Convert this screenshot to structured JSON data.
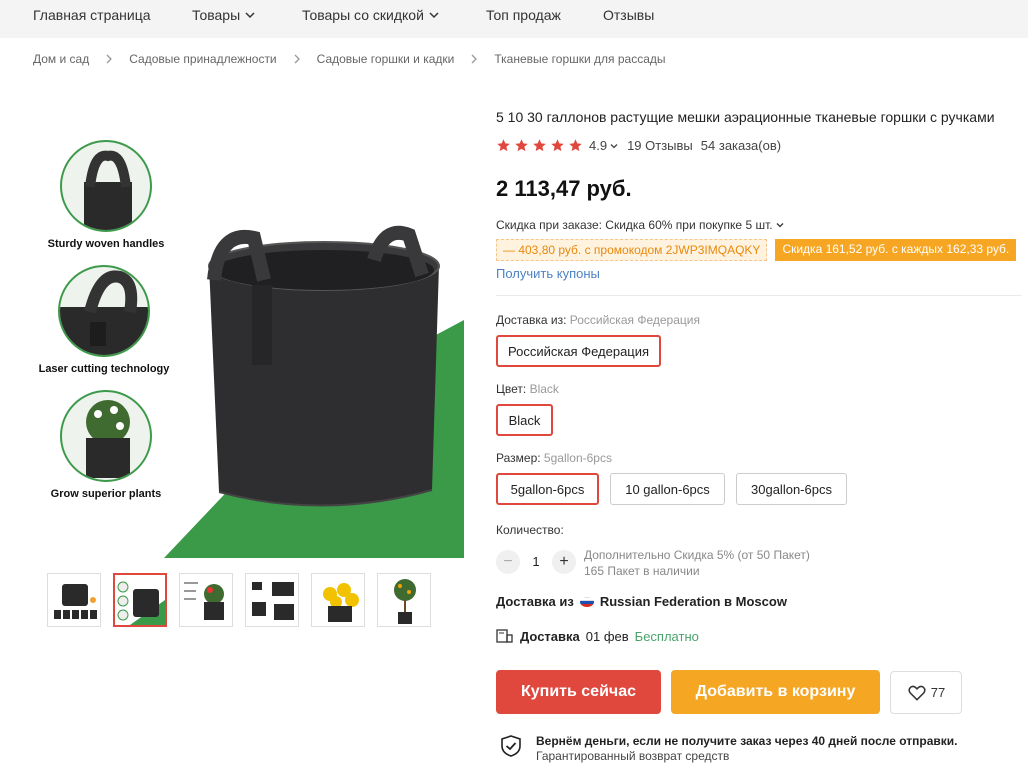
{
  "nav": {
    "items": [
      {
        "label": "Главная страница"
      },
      {
        "label": "Товары"
      },
      {
        "label": "Товары со скидкой"
      },
      {
        "label": "Топ продаж"
      },
      {
        "label": "Отзывы"
      }
    ]
  },
  "breadcrumb": [
    "Дом и сад",
    "Садовые принадлежности",
    "Садовые горшки и кадки",
    "Тканевые горшки для рассады"
  ],
  "gallery": {
    "features": [
      "Sturdy woven handles",
      "Laser cutting technology",
      "Grow superior plants"
    ],
    "thumbs_count": 6,
    "active_thumb": 2
  },
  "product": {
    "title": "5 10 30 галлонов растущие мешки аэрационные тканевые горшки с ручками",
    "rating": "4.9",
    "stars": 5,
    "reviews": "19 Отзывы",
    "orders": "54 заказа(ов)",
    "price": "2 113,47 руб.",
    "discount_line": "Скидка при заказе: Скидка 60% при покупке 5 шт.",
    "promo_code": "— 403,80 руб. с промокодом 2JWP3IMQAQKY",
    "promo_every": "Скидка 161,52 руб. с каждых 162,33 руб.",
    "coupons_link": "Получить купоны"
  },
  "options": {
    "ship_from_label": "Доставка из:",
    "ship_from_selected": "Российская Федерация",
    "ship_from_values": [
      "Российская Федерация"
    ],
    "color_label": "Цвет:",
    "color_selected": "Black",
    "color_values": [
      "Black"
    ],
    "size_label": "Размер:",
    "size_selected": "5gallon-6pcs",
    "size_values": [
      "5gallon-6pcs",
      "10 gallon-6pcs",
      "30gallon-6pcs"
    ]
  },
  "quantity": {
    "label": "Количество:",
    "minus": "−",
    "value": "1",
    "plus": "+",
    "extra_discount": "Дополнительно Скидка 5% (от 50 Пакет)",
    "in_stock": "165 Пакет в наличии"
  },
  "shipping": {
    "from_prefix": "Доставка из",
    "from_text": "Russian Federation в Moscow",
    "delivery_label": "Доставка",
    "delivery_date": "01 фев",
    "delivery_cost": "Бесплатно"
  },
  "actions": {
    "buy": "Купить сейчас",
    "cart": "Добавить в корзину",
    "wishlist_count": "77"
  },
  "guarantee": {
    "title": "Вернём деньги, если не получите заказ через 40 дней после отправки.",
    "subtitle": "Гарантированный возврат средств"
  },
  "colors": {
    "accent_red": "#e0483e",
    "accent_orange": "#f5a623",
    "link_blue": "#4c82c3",
    "star": "#e0483e",
    "green_free": "#4aa36b"
  }
}
